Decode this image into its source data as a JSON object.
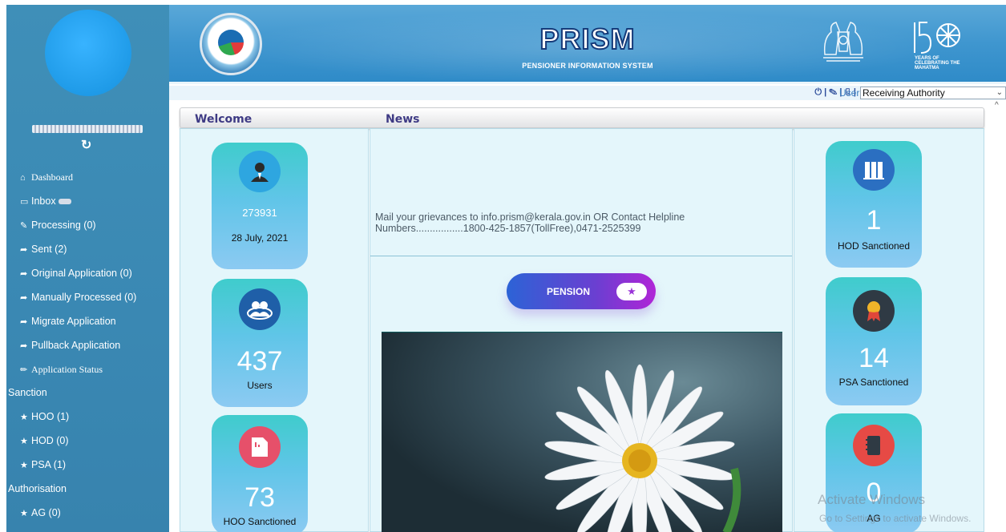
{
  "header": {
    "title": "PRISM",
    "subtitle": "PENSIONER INFORMATION SYSTEM",
    "years_badge": "YEARS OF CELEBRATING THE MAHATMA"
  },
  "toolbar": {
    "user_label": "User",
    "user_role": "Receiving Authority"
  },
  "sidebar": {
    "items": [
      {
        "label": "Dashboard",
        "icon": "home-icon"
      },
      {
        "label": "Inbox",
        "icon": "inbox-icon"
      },
      {
        "label": "Processing (0)",
        "icon": "edit-icon"
      },
      {
        "label": "Sent (2)",
        "icon": "share-icon"
      },
      {
        "label": "Original Application (0)",
        "icon": "share-icon"
      },
      {
        "label": "Manually Processed (0)",
        "icon": "share-icon"
      },
      {
        "label": "Migrate Application",
        "icon": "share-icon"
      },
      {
        "label": "Pullback Application",
        "icon": "share-icon"
      },
      {
        "label": "Application Status",
        "icon": "pencil-icon"
      }
    ],
    "sanction_title": "Sanction",
    "sanction_items": [
      "HOO (1)",
      "HOD (0)",
      "PSA (1)"
    ],
    "authorisation_title": "Authorisation",
    "authorisation_items": [
      "AG (0)"
    ]
  },
  "tabs": {
    "welcome": "Welcome",
    "news": "News"
  },
  "news": {
    "text": "Mail your grievances to info.prism@kerala.gov.in OR Contact Helpline Numbers.................1800-425-1857(TollFree),0471-2525399"
  },
  "left_cards": [
    {
      "value": "273931",
      "sub": "28 July, 2021"
    },
    {
      "value": "437",
      "label": "Users"
    },
    {
      "value": "73",
      "label": "HOO Sanctioned"
    }
  ],
  "right_cards": [
    {
      "value": "1",
      "label": "HOD Sanctioned"
    },
    {
      "value": "14",
      "label": "PSA Sanctioned"
    },
    {
      "value": "0",
      "label": "AG"
    }
  ],
  "pension_button": "PENSION",
  "watermark": {
    "line1": "Activate Windows",
    "line2": "Go to Settings to activate Windows."
  }
}
